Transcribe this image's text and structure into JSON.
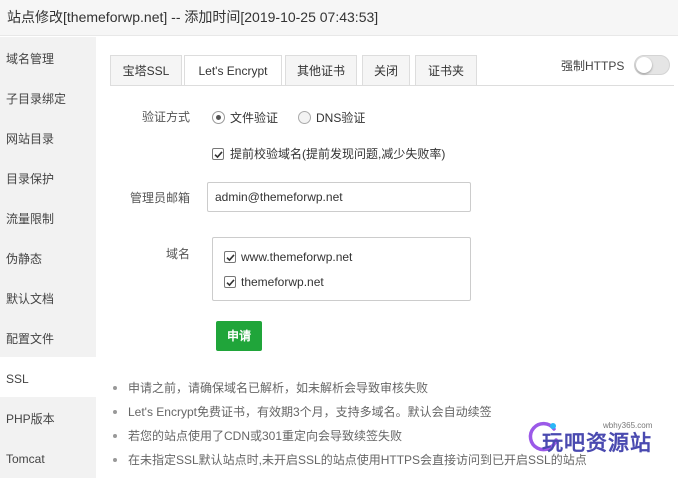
{
  "window": {
    "title": "站点修改[themeforwp.net] -- 添加时间[2019-10-25 07:43:53]"
  },
  "sidebar": {
    "items": [
      {
        "label": "域名管理"
      },
      {
        "label": "子目录绑定"
      },
      {
        "label": "网站目录"
      },
      {
        "label": "目录保护"
      },
      {
        "label": "流量限制"
      },
      {
        "label": "伪静态"
      },
      {
        "label": "默认文档"
      },
      {
        "label": "配置文件"
      },
      {
        "label": "SSL",
        "active": true
      },
      {
        "label": "PHP版本"
      },
      {
        "label": "Tomcat"
      }
    ]
  },
  "tabs": [
    {
      "label": "宝塔SSL"
    },
    {
      "label": "Let's Encrypt",
      "active": true
    },
    {
      "label": "其他证书"
    },
    {
      "label": "关闭"
    },
    {
      "label": "证书夹"
    }
  ],
  "force_https": {
    "label": "强制HTTPS",
    "enabled": false
  },
  "form": {
    "verify": {
      "label": "验证方式",
      "options": [
        {
          "label": "文件验证",
          "checked": true
        },
        {
          "label": "DNS验证",
          "checked": false
        }
      ],
      "precheck": {
        "label": "提前校验域名(提前发现问题,减少失败率)",
        "checked": true
      }
    },
    "email": {
      "label": "管理员邮箱",
      "value": "admin@themeforwp.net"
    },
    "domains": {
      "label": "域名",
      "items": [
        {
          "name": "www.themeforwp.net",
          "checked": true
        },
        {
          "name": "themeforwp.net",
          "checked": true
        }
      ]
    },
    "apply_label": "申请"
  },
  "notes": [
    "申请之前，请确保域名已解析，如未解析会导致审核失败",
    "Let's Encrypt免费证书，有效期3个月，支持多域名。默认会自动续签",
    "若您的站点使用了CDN或301重定向会导致续签失败",
    "在未指定SSL默认站点时,未开启SSL的站点使用HTTPS会直接访问到已开启SSL的站点"
  ],
  "watermark": {
    "url": "wbhy365.com",
    "text": "玩吧资源站"
  },
  "colors": {
    "accent": "#20a53a",
    "watermark": "#4a4ab0"
  }
}
